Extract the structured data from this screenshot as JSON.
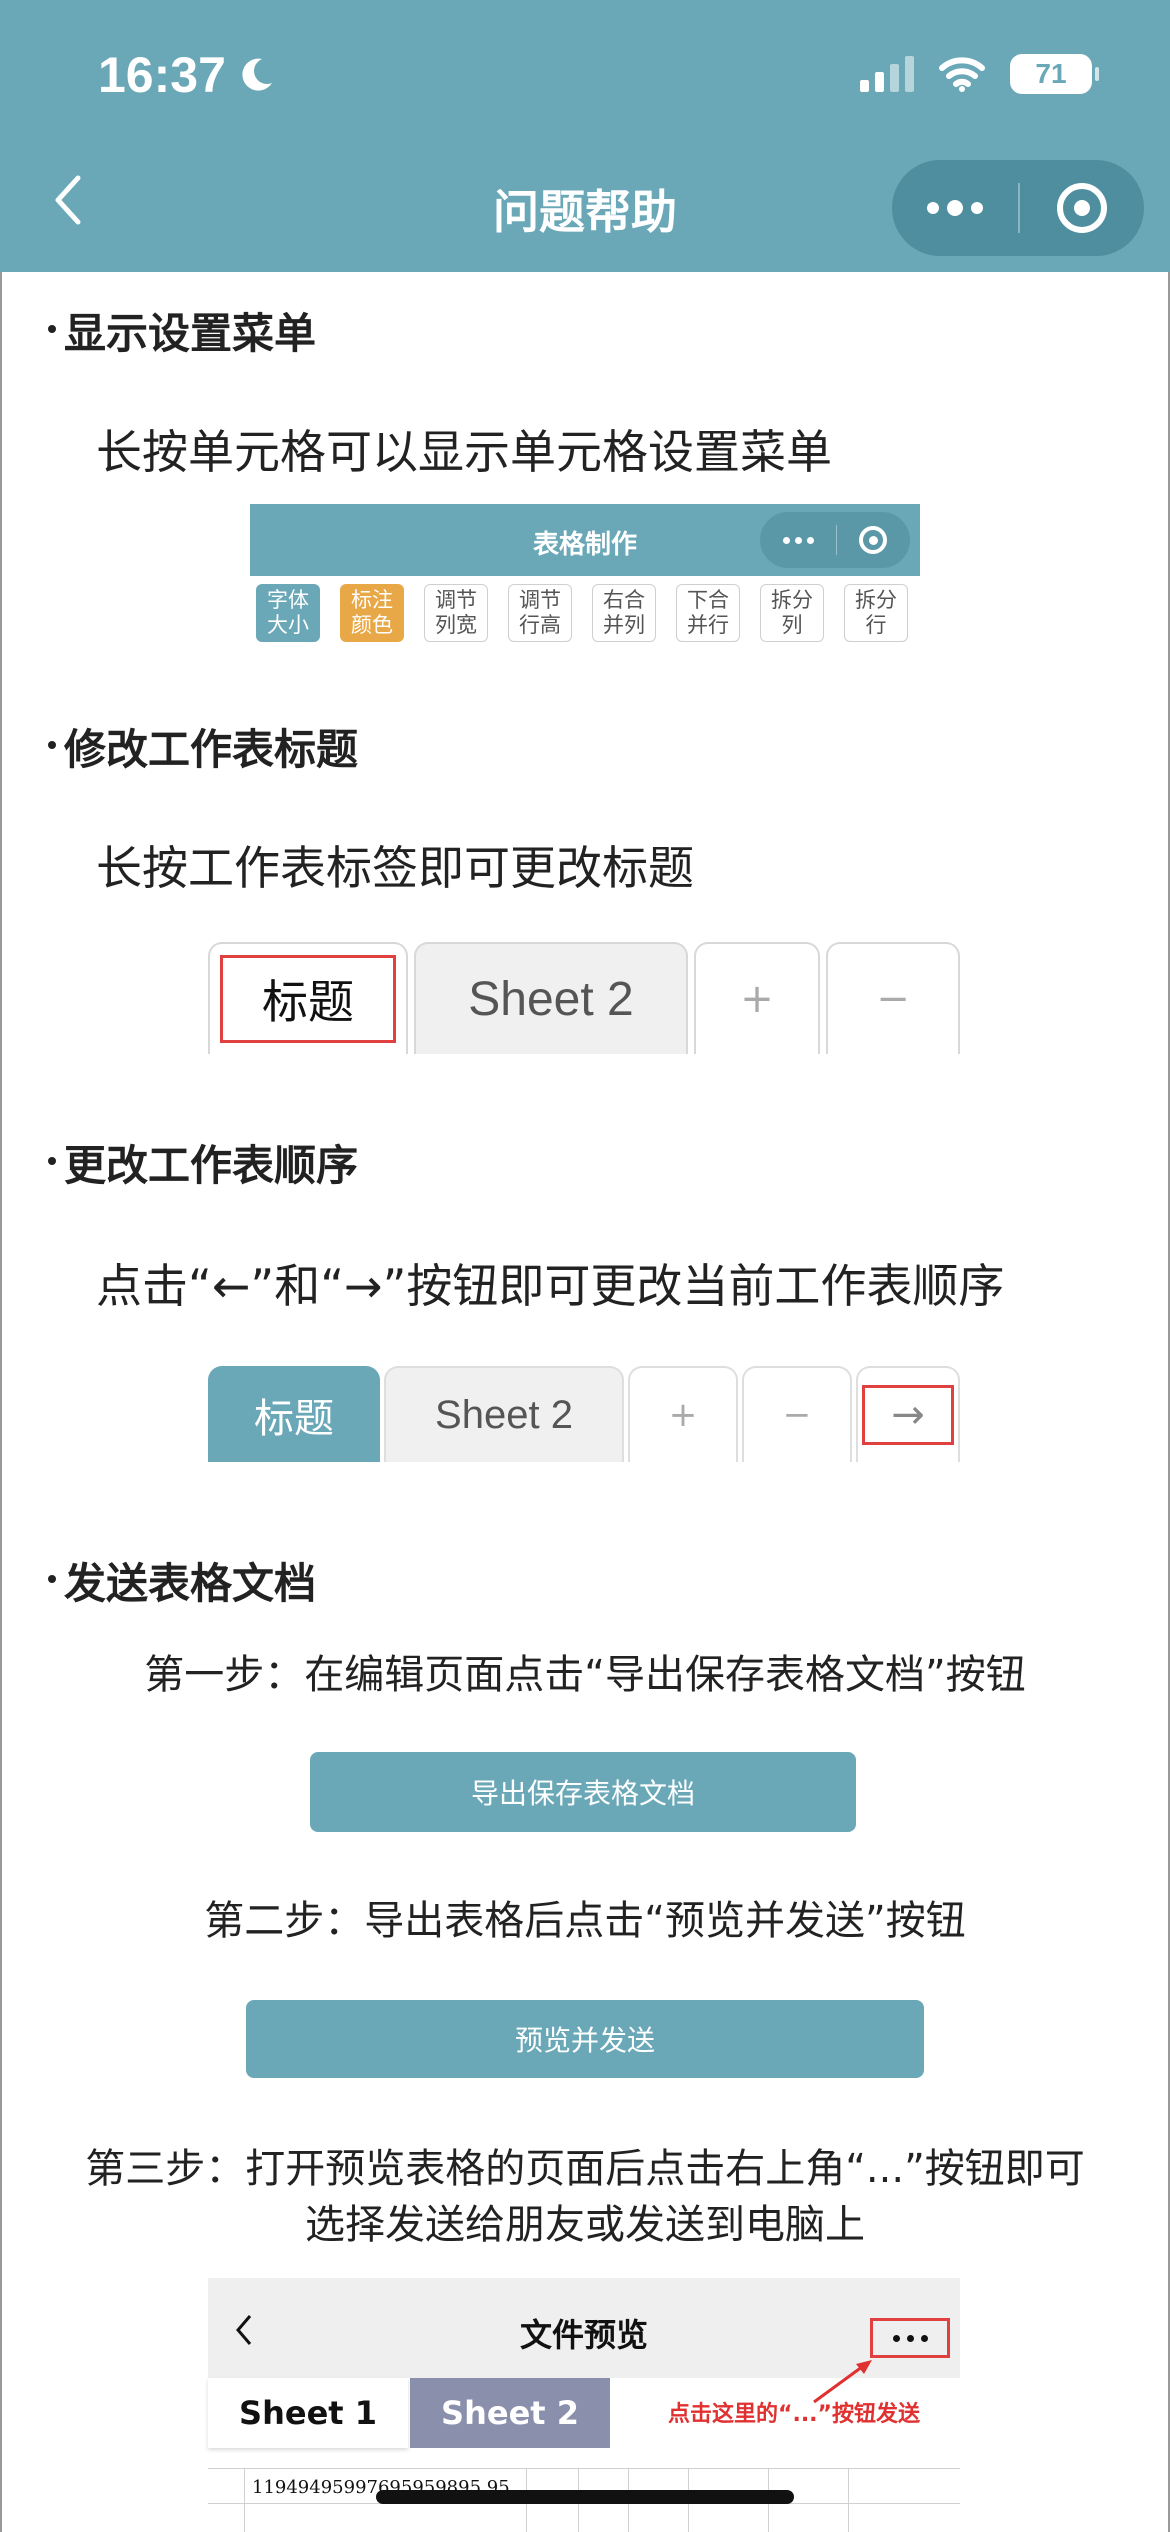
{
  "status_bar": {
    "time": "16:37",
    "battery": "71"
  },
  "nav": {
    "title": "问题帮助"
  },
  "sections": {
    "menu": {
      "heading": "显示设置菜单",
      "description": "长按单元格可以显示单元格设置菜单",
      "image": {
        "bar_title": "表格制作",
        "buttons": [
          {
            "line1": "字体",
            "line2": "大小",
            "style": "blue"
          },
          {
            "line1": "标注",
            "line2": "颜色",
            "style": "orange"
          },
          {
            "line1": "调节",
            "line2": "列宽",
            "style": "plain"
          },
          {
            "line1": "调节",
            "line2": "行高",
            "style": "plain"
          },
          {
            "line1": "右合",
            "line2": "并列",
            "style": "plain"
          },
          {
            "line1": "下合",
            "line2": "并行",
            "style": "plain"
          },
          {
            "line1": "拆分",
            "line2": "列",
            "style": "plain"
          },
          {
            "line1": "拆分",
            "line2": "行",
            "style": "plain"
          }
        ]
      }
    },
    "rename": {
      "heading": "修改工作表标题",
      "description": "长按工作表标签即可更改标题",
      "tabs": [
        "标题",
        "Sheet 2",
        "+",
        "−"
      ]
    },
    "order": {
      "heading": "更改工作表顺序",
      "description": "点击“←”和“→”按钮即可更改当前工作表顺序",
      "tabs": [
        "标题",
        "Sheet 2",
        "+",
        "−",
        "→"
      ]
    },
    "send": {
      "heading": "发送表格文档",
      "step1": "第一步：在编辑页面点击“导出保存表格文档”按钮",
      "button1": "导出保存表格文档",
      "step2": "第二步：导出表格后点击“预览并发送”按钮",
      "button2": "预览并发送",
      "step3_line1": "第三步：打开预览表格的页面后点击右上角“...”按钮即可",
      "step3_line2": "选择发送给朋友或发送到电脑上",
      "preview": {
        "title": "文件预览",
        "tab1": "Sheet 1",
        "tab2": "Sheet 2",
        "note": "点击这里的“...”按钮发送",
        "cell_text": "11949495997695959895 95"
      }
    }
  },
  "colors": {
    "primary": "#6aa8b8",
    "accent_orange": "#e8a848",
    "highlight_red": "#e04040"
  }
}
